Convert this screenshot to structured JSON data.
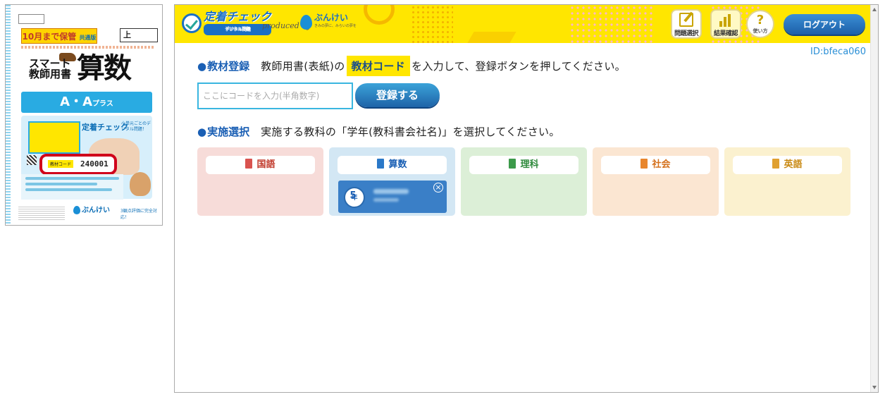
{
  "cover": {
    "keep_label": "10月まで保管",
    "version_label": "共通版",
    "volume": "上",
    "title_small_line1": "スマート",
    "title_small_line2": "教師用書",
    "title_large": "算数",
    "grade_level": "A・A",
    "grade_suffix": "プラス",
    "promo_logo": "定着チェック",
    "promo_sub": "小単元ごとのデジタル問題！",
    "code_tag": "教材コード",
    "code_value": "240001",
    "publisher": "ぶんけい",
    "eval_tag": "3観点評価に完全対応！"
  },
  "header": {
    "logo_text": "定着チェック",
    "logo_sub": "デジタル問題",
    "produced_by": "produced by",
    "publisher_name": "ぶんけい",
    "publisher_tagline": "きみの夢に、みらいの夢を",
    "nav": [
      {
        "label": "問題選択",
        "icon": "edit-icon"
      },
      {
        "label": "結果確認",
        "icon": "bar-chart-icon",
        "active": true
      },
      {
        "label": "使い方",
        "icon": "question-icon"
      }
    ],
    "logout_label": "ログアウト"
  },
  "user": {
    "id": "ID:bfeca060"
  },
  "register": {
    "title": "教材登録",
    "desc_before": "教師用書(表紙)の",
    "highlight": "教材コード",
    "desc_after": "を入力して、登録ボタンを押してください。",
    "input_placeholder": "ここにコードを入力(半角数字)",
    "input_value": "",
    "button_label": "登録する"
  },
  "select": {
    "title": "実施選択",
    "desc": "実施する教科の「学年(教科書会社名)」を選択してください。"
  },
  "subjects": [
    {
      "label": "国語",
      "bg": "#f7dcd9",
      "book_color": "#d9534f",
      "text_color": "#c0392b"
    },
    {
      "label": "算数",
      "bg": "#d3e7f4",
      "book_color": "#2a78c8",
      "text_color": "#1a5fb4"
    },
    {
      "label": "理科",
      "bg": "#dcefd7",
      "book_color": "#3c9a4a",
      "text_color": "#2e8a3c"
    },
    {
      "label": "社会",
      "bg": "#fbe6d2",
      "book_color": "#e8862d",
      "text_color": "#d4701c"
    },
    {
      "label": "英語",
      "bg": "#fbf1cf",
      "book_color": "#e0a030",
      "text_color": "#c98a14"
    }
  ],
  "course": {
    "grade_num": "5",
    "grade_unit": "年"
  },
  "colors": {
    "header_bg": "#ffe600",
    "accent_blue": "#1a5fb4",
    "button_blue": "#1e63a8"
  }
}
